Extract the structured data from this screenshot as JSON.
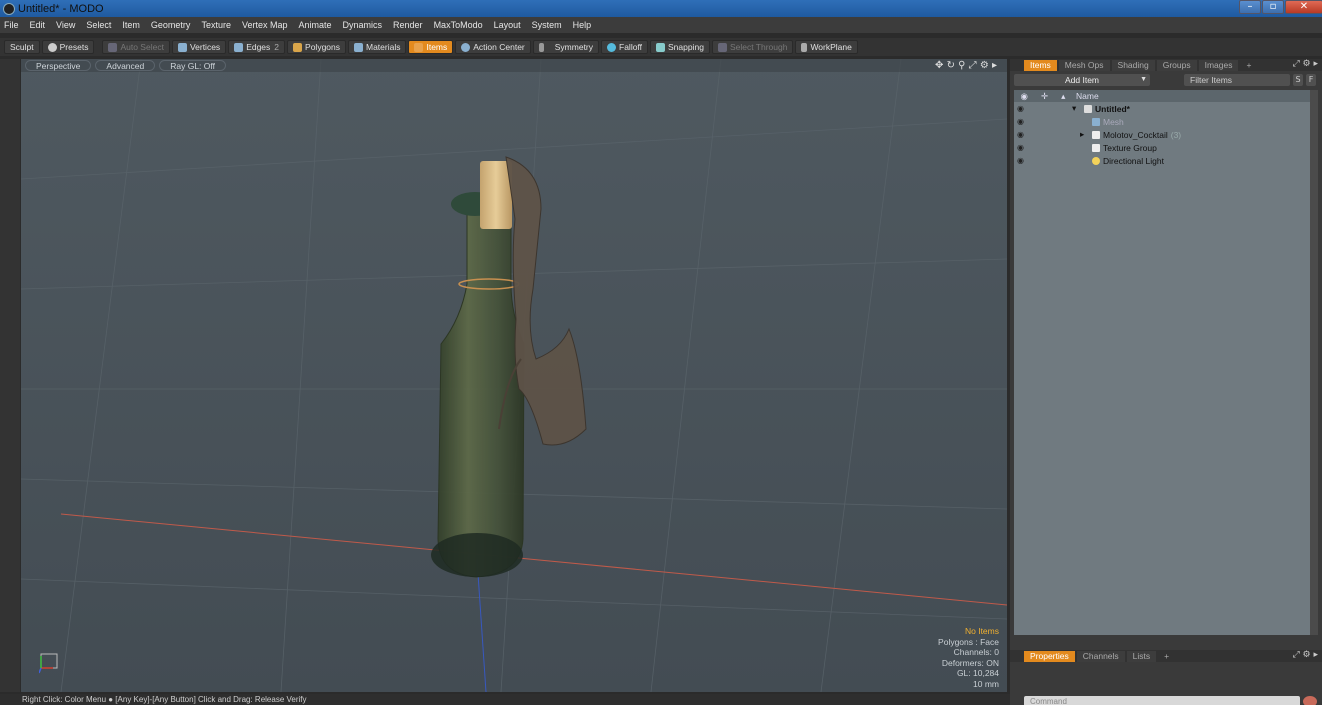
{
  "window": {
    "title": "Untitled* - MODO"
  },
  "menu": [
    "File",
    "Edit",
    "View",
    "Select",
    "Item",
    "Geometry",
    "Texture",
    "Vertex Map",
    "Animate",
    "Dynamics",
    "Render",
    "MaxToModo",
    "Layout",
    "System",
    "Help"
  ],
  "toolbar": {
    "sculpt": "Sculpt",
    "presets": "Presets",
    "auto_select": "Auto Select",
    "vertices": "Vertices",
    "edges": "Edges",
    "edges_count": "2",
    "polygons": "Polygons",
    "materials": "Materials",
    "items": "Items",
    "action_center": "Action Center",
    "symmetry": "Symmetry",
    "falloff": "Falloff",
    "snapping": "Snapping",
    "select_through": "Select Through",
    "workplane": "WorkPlane",
    "accent_color": "#e38a1e"
  },
  "viewport": {
    "tabs": [
      "Perspective",
      "Advanced",
      "Ray GL: Off"
    ],
    "info": {
      "selection": "No Items",
      "polygons": "Polygons : Face",
      "channels": "Channels: 0",
      "deformers": "Deformers: ON",
      "gl": "GL: 10,284",
      "scale": "10 mm"
    }
  },
  "status": {
    "text": "Right Click: Color Menu ● [Any Key]-[Any Button] Click and Drag: Release Verify"
  },
  "right_panel": {
    "tabs": [
      "Items",
      "Mesh Ops",
      "Shading",
      "Groups",
      "Images",
      "+"
    ],
    "add_item": "Add Item",
    "filter_placeholder": "Filter Items",
    "btn_s": "S",
    "btn_f": "F",
    "column_name": "Name",
    "tree": [
      {
        "label": "Untitled*",
        "bold": true
      },
      {
        "label": "Mesh",
        "dim": true
      },
      {
        "label": "Molotov_Cocktail",
        "count": "(3)"
      },
      {
        "label": "Texture Group"
      },
      {
        "label": "Directional Light"
      }
    ],
    "bottom_tabs": [
      "Properties",
      "Channels",
      "Lists",
      "+"
    ],
    "command_placeholder": "Command"
  }
}
